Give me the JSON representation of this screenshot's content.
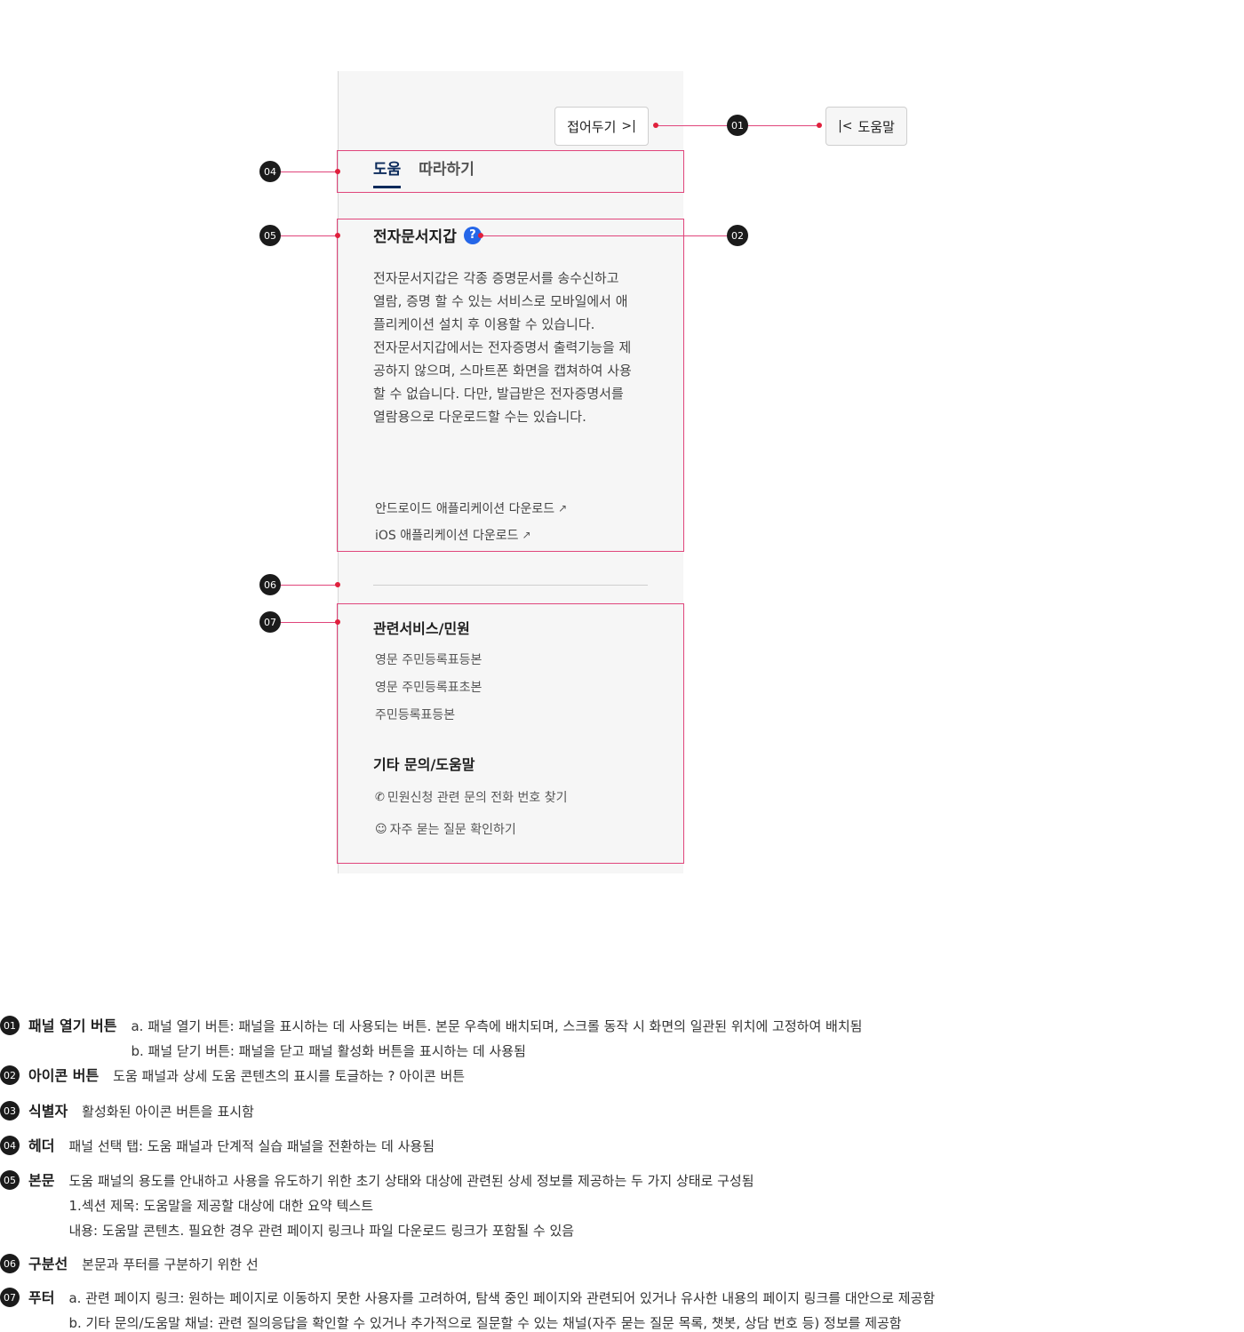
{
  "panel": {
    "collapse_button": "접어두기",
    "open_button": "도움말",
    "tabs": [
      "도움",
      "따라하기"
    ],
    "section_title": "전자문서지갑",
    "body_paragraphs": [
      "전자문서지갑은 각종 증명문서를 송수신하고 열람, 증명 할 수 있는 서비스로 모바일에서 애플리케이션 설치 후 이용할 수 있습니다.",
      "전자문서지갑에서는 전자증명서 출력기능을 제공하지 않으며, 스마트폰 화면을 캡쳐하여 사용할 수 없습니다. 다만, 발급받은 전자증명서를 열람용으로 다운로드할 수는 있습니다."
    ],
    "download_links": [
      "안드로이드 애플리케이션 다운로드",
      "iOS 애플리케이션 다운로드"
    ],
    "footer": {
      "related_title": "관련서비스/민원",
      "related_links": [
        "영문 주민등록표등본",
        "영문 주민등록표초본",
        "주민등록표등본"
      ],
      "help_title": "기타 문의/도움말",
      "help_links": [
        "민원신청 관련 문의 전화 번호 찾기",
        "자주 묻는 질문 확인하기"
      ]
    }
  },
  "badges": [
    "01",
    "02",
    "04",
    "05",
    "06",
    "07"
  ],
  "legend": [
    {
      "num": "01",
      "term": "패널 열기 버튼",
      "lines": [
        "a. 패널 열기 버튼: 패널을 표시하는 데 사용되는 버튼. 본문 우측에 배치되며, 스크롤 동작 시 화면의 일관된 위치에 고정하여 배치됨",
        "b. 패널 닫기 버튼: 패널을 닫고 패널 활성화 버튼을 표시하는 데 사용됨"
      ]
    },
    {
      "num": "02",
      "term": "아이콘 버튼",
      "lines": [
        "도움 패널과 상세 도움 콘텐츠의 표시를 토글하는 ? 아이콘 버튼"
      ]
    },
    {
      "num": "03",
      "term": "식별자",
      "lines": [
        "활성화된 아이콘 버튼을 표시함"
      ]
    },
    {
      "num": "04",
      "term": "헤더",
      "lines": [
        "패널 선택 탭: 도움 패널과 단계적 실습 패널을 전환하는 데 사용됨"
      ]
    },
    {
      "num": "05",
      "term": "본문",
      "lines": [
        "도움 패널의 용도를 안내하고 사용을 유도하기 위한 초기 상태와 대상에 관련된 상세 정보를 제공하는 두 가지 상태로 구성됨",
        "1.섹션 제목: 도움말을 제공할 대상에 대한 요약 텍스트",
        "내용: 도움말 콘텐츠. 필요한 경우 관련 페이지 링크나 파일 다운로드 링크가 포함될 수 있음"
      ]
    },
    {
      "num": "06",
      "term": "구분선",
      "lines": [
        "본문과 푸터를 구분하기 위한 선"
      ]
    },
    {
      "num": "07",
      "term": "푸터",
      "lines": [
        "a. 관련 페이지 링크: 원하는 페이지로 이동하지 못한 사용자를 고려하여, 탐색 중인 페이지와 관련되어 있거나 유사한 내용의 페이지 링크를 대안으로 제공함",
        "b. 기타 문의/도움말 채널: 관련 질의응답을 확인할 수 있거나 추가적으로 질문할 수 있는 채널(자주 묻는 질문 목록, 챗봇, 상담 번호 등) 정보를 제공함"
      ]
    }
  ]
}
